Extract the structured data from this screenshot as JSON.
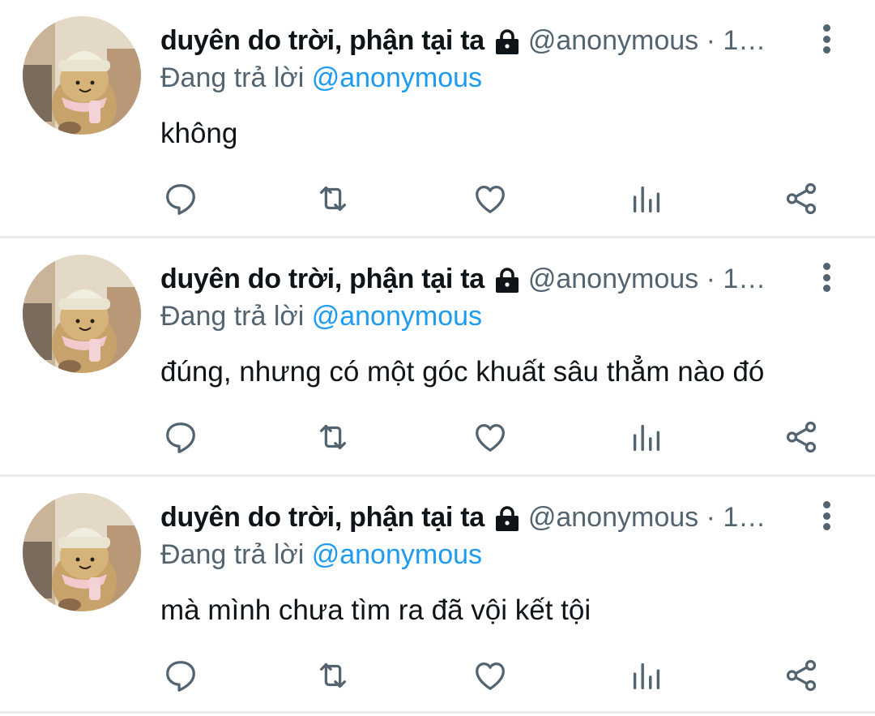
{
  "tweets": [
    {
      "name": "duyên do trời, phận tại ta",
      "handle_time": "@anonymous · 1…",
      "reply_prefix": "Đang trả lời",
      "reply_mention": "@anonymous",
      "text": "không"
    },
    {
      "name": "duyên do trời, phận tại ta",
      "handle_time": "@anonymous · 1…",
      "reply_prefix": "Đang trả lời",
      "reply_mention": "@anonymous",
      "text": "đúng, nhưng có một góc khuất sâu thẳm nào đó"
    },
    {
      "name": "duyên do trời, phận tại ta",
      "handle_time": "@anonymous · 1…",
      "reply_prefix": "Đang trả lời",
      "reply_mention": "@anonymous",
      "text": "mà mình chưa tìm ra đã vội kết tội"
    }
  ],
  "icons": {
    "protected": "lock-icon",
    "more": "more-vertical-icon",
    "reply": "reply-icon",
    "retweet": "retweet-icon",
    "like": "heart-icon",
    "analytics": "analytics-icon",
    "share": "share-icon"
  },
  "colors": {
    "text": "#0f1419",
    "secondary": "#536471",
    "mention": "#1d9bf0",
    "divider": "#e8ecef"
  }
}
